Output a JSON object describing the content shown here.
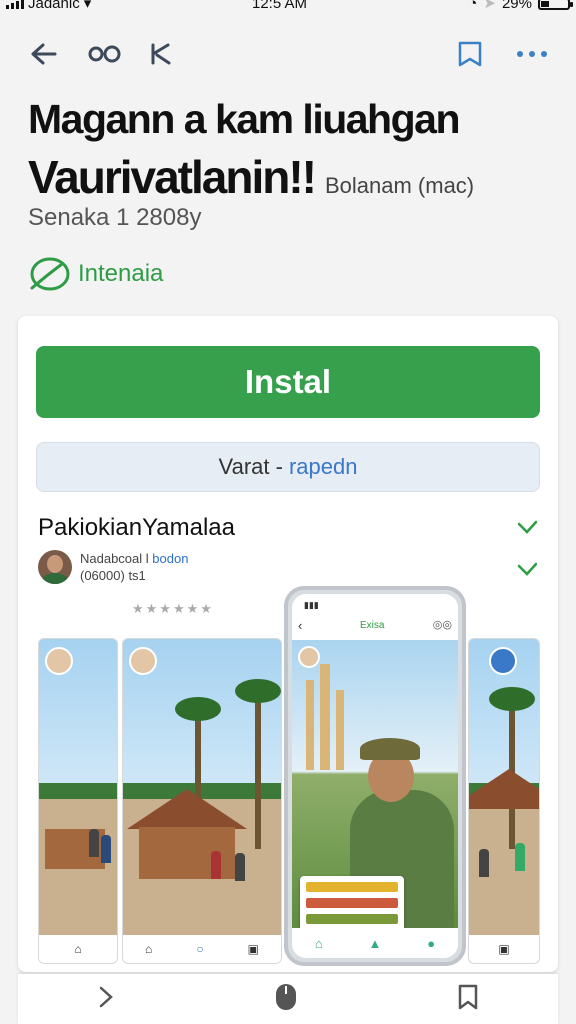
{
  "status_bar": {
    "carrier": "Jadanic",
    "time": "12:5 AM",
    "battery": "29%",
    "battery_level": 0.29
  },
  "nav": {
    "back": "back-arrow-icon",
    "share": "share-icon",
    "bookmark": "bookmark-icon",
    "more": "more-icon"
  },
  "app": {
    "title": "Magann a kam liuahgan",
    "subtitle": "Vaurivatlanin!!",
    "platform": "Bolanam (mac)",
    "meta": "Senaka 1 2808y",
    "badge": "Intenaia"
  },
  "actions": {
    "install": "Instal",
    "variant_prefix": "Varat -",
    "variant_accent": "rapedn"
  },
  "developer": {
    "name": "PakiokianYamalaa",
    "reviewer_line1": "Nadabcoal l",
    "reviewer_line1_blue": "bodon",
    "reviewer_line2": "(06000)",
    "reviewer_line2_suffix": "ts1",
    "stars": "★★★★★★"
  },
  "screenshots": {
    "phone_header": "Exisa"
  },
  "colors": {
    "accent_green": "#36a04c",
    "link_blue": "#2d6fd0"
  }
}
